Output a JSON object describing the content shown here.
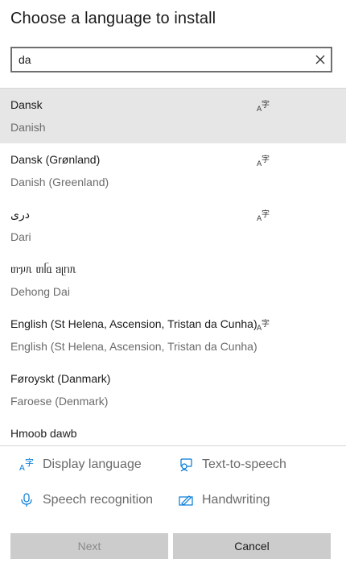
{
  "dialog": {
    "title": "Choose a language to install"
  },
  "search": {
    "value": "da",
    "placeholder": ""
  },
  "languages": [
    {
      "native": "Dansk",
      "english": "Danish",
      "display_language": true,
      "selected": true
    },
    {
      "native": "Dansk (Grønland)",
      "english": "Danish (Greenland)",
      "display_language": true,
      "selected": false
    },
    {
      "native": "درى",
      "english": "Dari",
      "display_language": true,
      "selected": false
    },
    {
      "native": "ᥖᥭᥰ ᥖᥬᥲ ᥑᥨᥒᥰ",
      "english": "Dehong Dai",
      "display_language": false,
      "selected": false
    },
    {
      "native": "English (St Helena, Ascension, Tristan da Cunha)",
      "english": "English (St Helena, Ascension, Tristan da Cunha)",
      "display_language": true,
      "selected": false
    },
    {
      "native": "Føroyskt (Danmark)",
      "english": "Faroese (Denmark)",
      "display_language": false,
      "selected": false
    },
    {
      "native": "Hmoob dawb",
      "english": "",
      "display_language": false,
      "selected": false
    }
  ],
  "legend": {
    "display_language": "Display language",
    "text_to_speech": "Text-to-speech",
    "speech_recognition": "Speech recognition",
    "handwriting": "Handwriting"
  },
  "buttons": {
    "next": "Next",
    "cancel": "Cancel"
  },
  "colors": {
    "accent": "#0078d7",
    "selected_row": "#e6e6e6",
    "button": "#cccccc"
  }
}
